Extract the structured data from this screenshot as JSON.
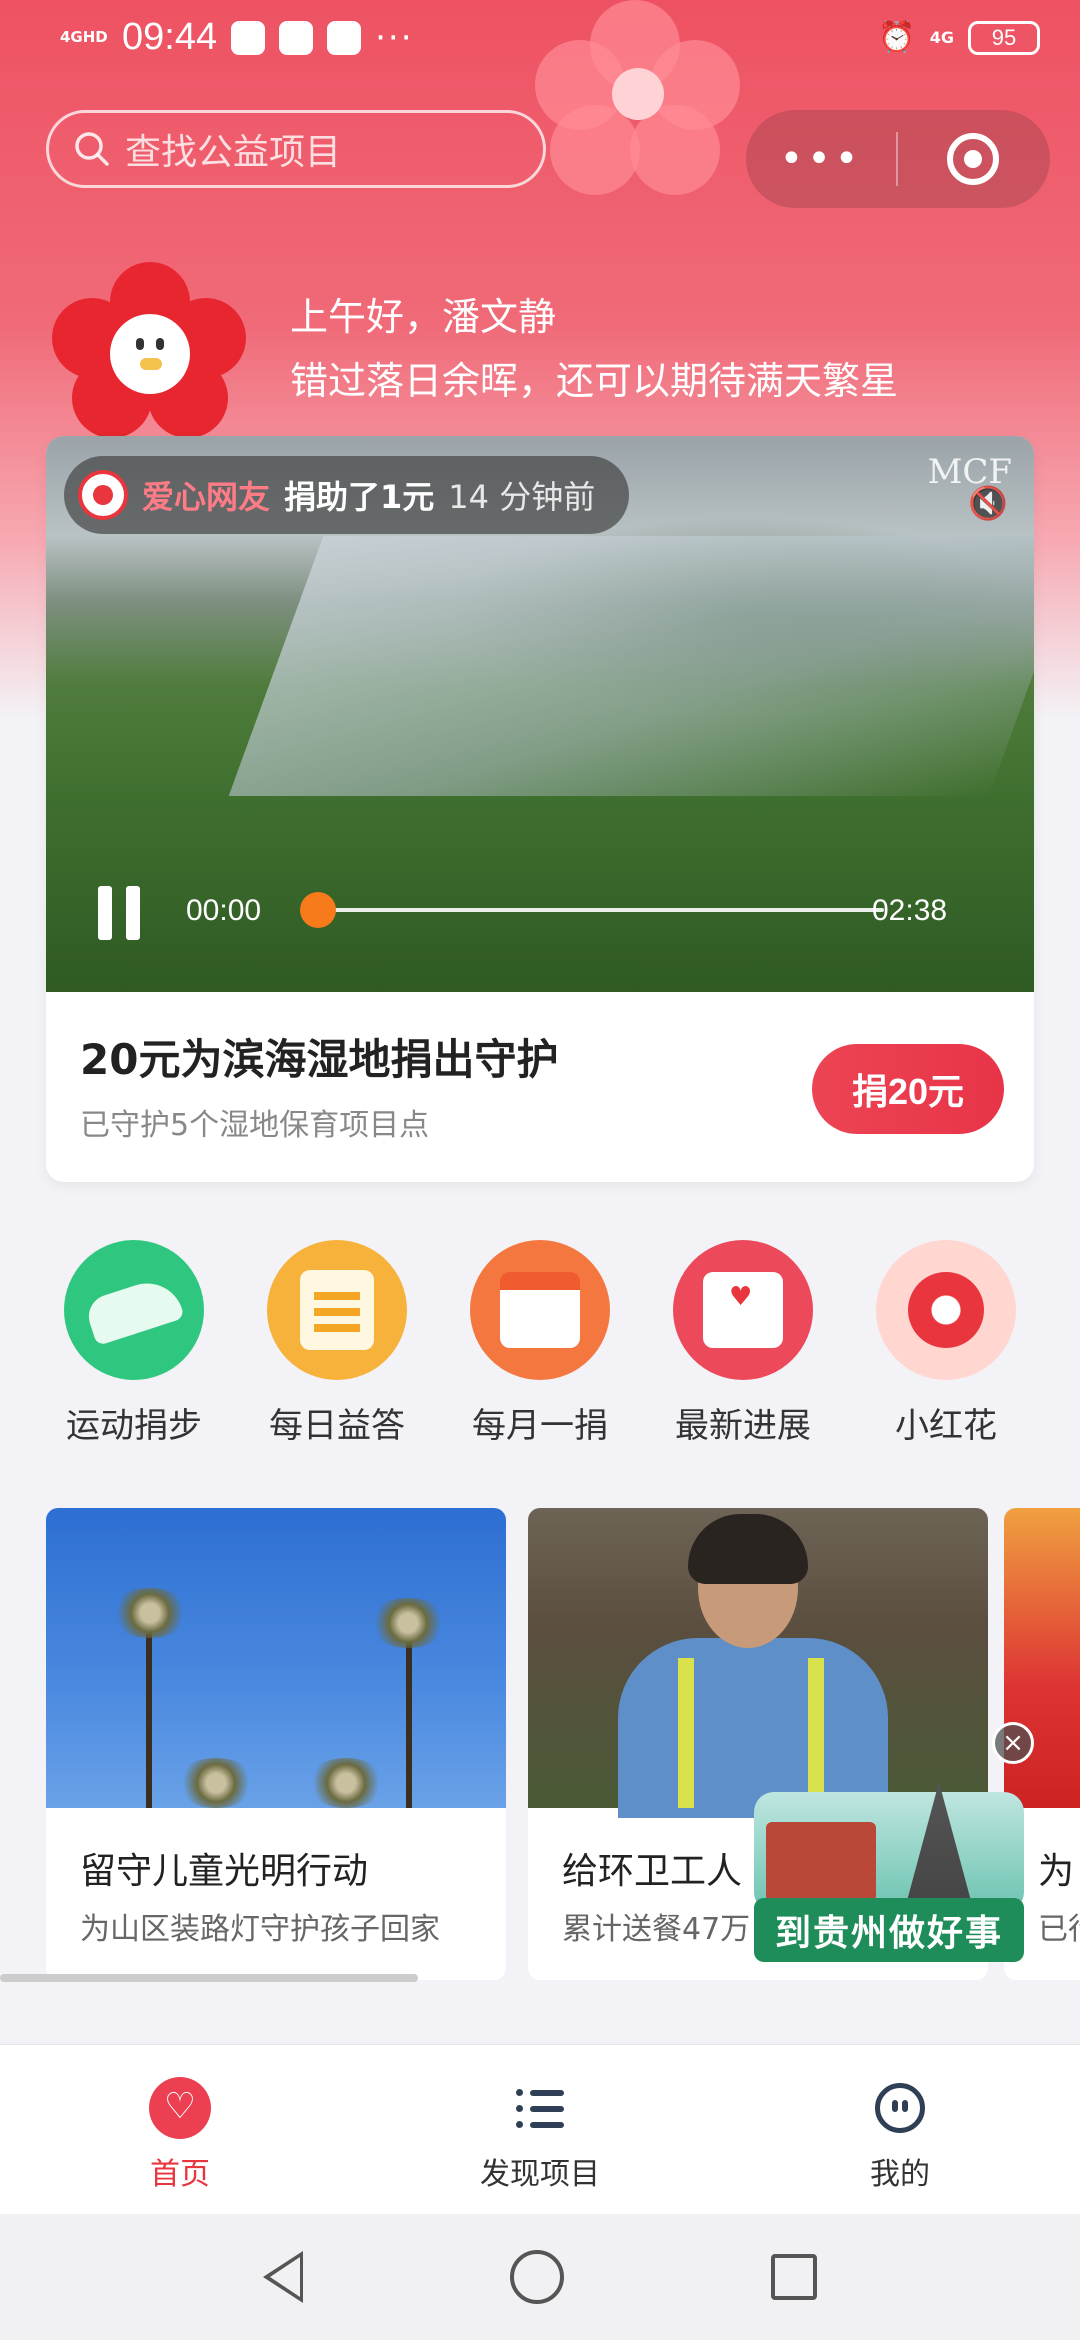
{
  "status_bar": {
    "network": "4GHD",
    "time": "09:44",
    "network_right": "4G",
    "battery": "95",
    "dots": "···"
  },
  "search": {
    "placeholder": "查找公益项目",
    "icon": "search-icon"
  },
  "capsule": {
    "more": "•••",
    "icons": [
      "more-icon",
      "target-icon"
    ]
  },
  "greeting": {
    "line1": "上午好，潘文静",
    "line2": "错过落日余晖，还可以期待满天繁星"
  },
  "video_card": {
    "donor": {
      "name": "爱心网友",
      "action": "捐助了1元",
      "time": "14 分钟前"
    },
    "logo": "MCF",
    "current_time": "00:00",
    "total_time": "02:38",
    "progress": 0,
    "title": "20元为滨海湿地捐出守护",
    "subtitle": "已守护5个湿地保育项目点",
    "donate_label": "捐20元"
  },
  "quick_entries": [
    {
      "label": "运动捐步",
      "icon": "shoe-icon",
      "color": "#2fc77f"
    },
    {
      "label": "每日益答",
      "icon": "quiz-sheet-icon",
      "color": "#f7b23b"
    },
    {
      "label": "每月一捐",
      "icon": "calendar-icon",
      "color": "#f4773f"
    },
    {
      "label": "最新进展",
      "icon": "inbox-heart-icon",
      "color": "#ec4a5b"
    },
    {
      "label": "小红花",
      "icon": "red-flower-icon",
      "color": "#ffd6d0"
    }
  ],
  "projects": [
    {
      "title": "留守儿童光明行动",
      "subtitle": "为山区装路灯守护孩子回家"
    },
    {
      "title": "给环卫工人",
      "subtitle": "累计送餐47万"
    },
    {
      "title": "为",
      "subtitle": "已行"
    }
  ],
  "floating_ad": {
    "text": "到贵州做好事",
    "close": "×"
  },
  "bottom_nav": [
    {
      "label": "首页",
      "icon": "home-heart-icon",
      "active": true
    },
    {
      "label": "发现项目",
      "icon": "list-icon",
      "active": false
    },
    {
      "label": "我的",
      "icon": "profile-icon",
      "active": false
    }
  ]
}
